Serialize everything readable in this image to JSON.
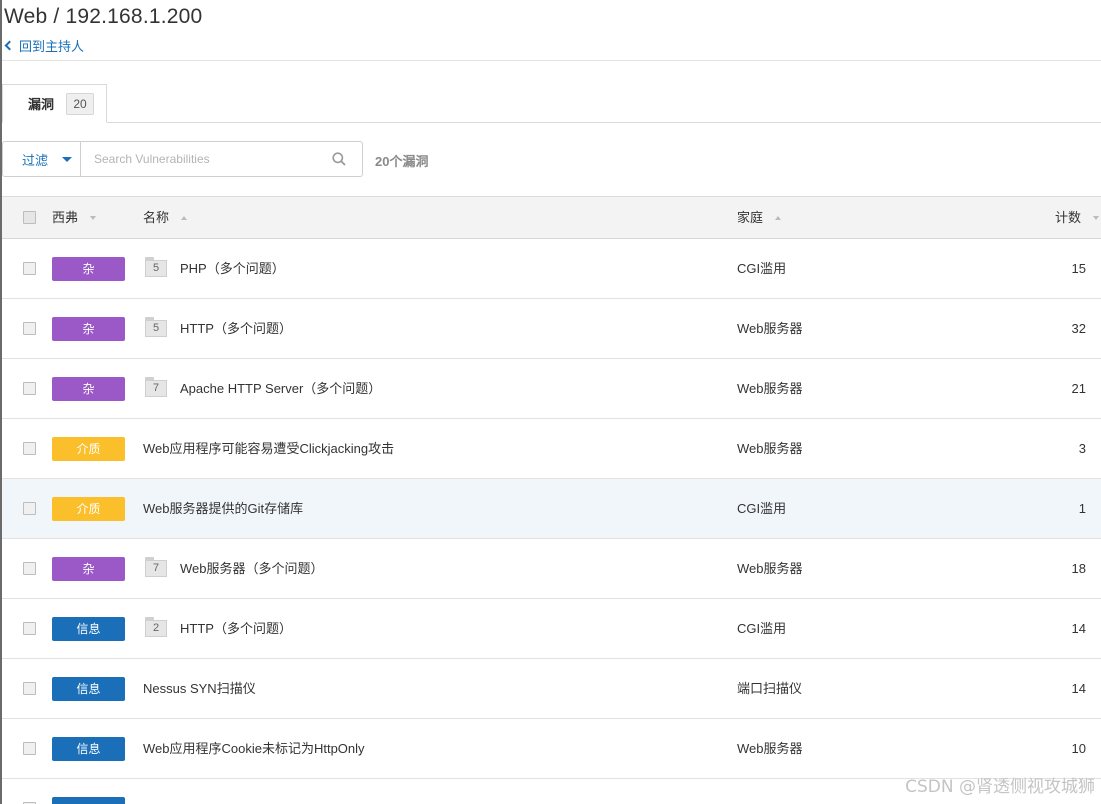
{
  "header": {
    "title": "Web / 192.168.1.200",
    "back_label": "回到主持人"
  },
  "tabs": [
    {
      "label": "漏洞",
      "count": "20"
    }
  ],
  "toolbar": {
    "filter_label": "过滤",
    "search_placeholder": "Search Vulnerabilities",
    "result_count": "20个漏洞"
  },
  "table": {
    "columns": {
      "severity": "西弗",
      "name": "名称",
      "family": "家庭",
      "count": "计数"
    },
    "rows": [
      {
        "severity": "杂",
        "level": "mixed",
        "folder": "5",
        "name": "PHP（多个问题）",
        "family": "CGI滥用",
        "count": "15"
      },
      {
        "severity": "杂",
        "level": "mixed",
        "folder": "5",
        "name": "HTTP（多个问题）",
        "family": "Web服务器",
        "count": "32"
      },
      {
        "severity": "杂",
        "level": "mixed",
        "folder": "7",
        "name": "Apache HTTP Server（多个问题）",
        "family": "Web服务器",
        "count": "21"
      },
      {
        "severity": "介质",
        "level": "medium",
        "folder": "",
        "name": "Web应用程序可能容易遭受Clickjacking攻击",
        "family": "Web服务器",
        "count": "3"
      },
      {
        "severity": "介质",
        "level": "medium",
        "folder": "",
        "name": "Web服务器提供的Git存储库",
        "family": "CGI滥用",
        "count": "1"
      },
      {
        "severity": "杂",
        "level": "mixed",
        "folder": "7",
        "name": "Web服务器（多个问题）",
        "family": "Web服务器",
        "count": "18"
      },
      {
        "severity": "信息",
        "level": "info",
        "folder": "2",
        "name": "HTTP（多个问题）",
        "family": "CGI滥用",
        "count": "14"
      },
      {
        "severity": "信息",
        "level": "info",
        "folder": "",
        "name": "Nessus SYN扫描仪",
        "family": "端口扫描仪",
        "count": "14"
      },
      {
        "severity": "信息",
        "level": "info",
        "folder": "",
        "name": "Web应用程序Cookie未标记为HttpOnly",
        "family": "Web服务器",
        "count": "10"
      }
    ]
  },
  "colors": {
    "mixed": "#9b59c7",
    "medium": "#fbbf2c",
    "info": "#1a6fb8",
    "link": "#1a6fb8"
  },
  "watermark": "CSDN @肾透侧视攻城狮"
}
